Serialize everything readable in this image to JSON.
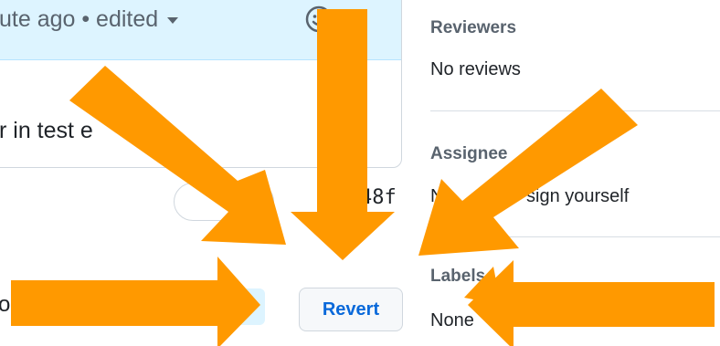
{
  "comment": {
    "meta": "ute ago • edited",
    "body_partial": "r in test e"
  },
  "commit": {
    "sha_partial": "48f"
  },
  "actions": {
    "left_partial": "o",
    "revert_label": "Revert"
  },
  "sidebar": {
    "reviewers": {
      "title": "Reviewers",
      "value": "No reviews"
    },
    "assignees": {
      "title": "Assignee",
      "value_prefix": "No",
      "value_suffix": "sign yourself"
    },
    "labels": {
      "title": "Labels",
      "value": "None"
    }
  },
  "overlay": {
    "arrow_color": "#ff9900",
    "arrow_count": 6
  },
  "colors": {
    "header_bg": "#ddf4ff",
    "link_blue": "#0969da",
    "muted": "#59636e"
  },
  "icons": [
    "smiley-icon",
    "chevron-down-icon",
    "arrow-icon"
  ]
}
